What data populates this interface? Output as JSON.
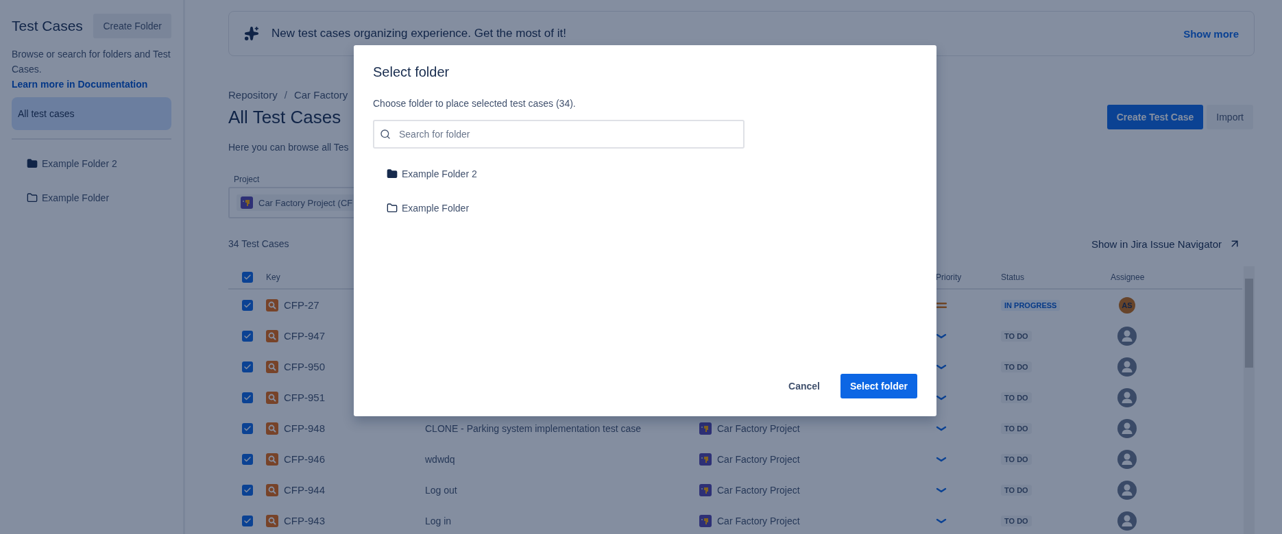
{
  "sidebar": {
    "title": "Test Cases",
    "create_button": "Create Folder",
    "description": "Browse or search for folders and Test Cases.",
    "doc_link": "Learn more in Documentation",
    "items": [
      {
        "label": "All test cases",
        "selected": true
      }
    ],
    "folders": [
      {
        "label": "Example Folder 2",
        "kind": "filled"
      },
      {
        "label": "Example Folder",
        "kind": "outline"
      }
    ]
  },
  "banner": {
    "text": "New test cases organizing experience. Get the most of it!",
    "link": "Show more"
  },
  "breadcrumb": {
    "separator": "/",
    "items": [
      "Repository",
      "Car Factory"
    ]
  },
  "page_title": "All Test Cases",
  "actions": [
    {
      "label": "Create Test Case",
      "kind": "primary"
    },
    {
      "label": "Import",
      "kind": "secondary"
    }
  ],
  "subtitle": "Here you can browse all Tes",
  "project_filter": {
    "label": "Project",
    "value": "Car Factory Project (CF"
  },
  "count": "34 Test Cases",
  "navigator_link": "Show in Jira Issue Navigator",
  "table": {
    "all_checked": true,
    "columns": {
      "key": "Key",
      "priority": "Priority",
      "status": "Status",
      "assignee": "Assignee"
    },
    "rows": [
      {
        "checked": true,
        "key": "CFP-27",
        "priority": {
          "kind": "medium"
        },
        "status": {
          "label": "IN PROGRESS",
          "kind": "in_progress"
        },
        "assignee": {
          "kind": "initials",
          "initials": "AS"
        }
      },
      {
        "checked": true,
        "key": "CFP-947",
        "priority": {
          "kind": "low"
        },
        "status": {
          "label": "TO DO",
          "kind": "todo"
        },
        "assignee": {
          "kind": "unassigned"
        }
      },
      {
        "checked": true,
        "key": "CFP-950",
        "priority": {
          "kind": "low"
        },
        "status": {
          "label": "TO DO",
          "kind": "todo"
        },
        "assignee": {
          "kind": "unassigned"
        }
      },
      {
        "checked": true,
        "key": "CFP-951",
        "priority": {
          "kind": "low"
        },
        "status": {
          "label": "TO DO",
          "kind": "todo"
        },
        "assignee": {
          "kind": "unassigned"
        }
      },
      {
        "checked": true,
        "key": "CFP-948",
        "summary": "CLONE - Parking system implementation test case",
        "project": "Car Factory Project",
        "priority": {
          "kind": "low"
        },
        "status": {
          "label": "TO DO",
          "kind": "todo"
        },
        "assignee": {
          "kind": "unassigned"
        }
      },
      {
        "checked": true,
        "key": "CFP-946",
        "summary": "wdwdq",
        "project": "Car Factory Project",
        "priority": {
          "kind": "low"
        },
        "status": {
          "label": "TO DO",
          "kind": "todo"
        },
        "assignee": {
          "kind": "unassigned"
        }
      },
      {
        "checked": true,
        "key": "CFP-944",
        "summary": "Log out",
        "project": "Car Factory Project",
        "priority": {
          "kind": "low"
        },
        "status": {
          "label": "TO DO",
          "kind": "todo"
        },
        "assignee": {
          "kind": "unassigned"
        }
      },
      {
        "checked": true,
        "key": "CFP-943",
        "summary": "Log in",
        "project": "Car Factory Project",
        "priority": {
          "kind": "low"
        },
        "status": {
          "label": "TO DO",
          "kind": "todo"
        },
        "assignee": {
          "kind": "unassigned"
        }
      }
    ]
  },
  "modal": {
    "title": "Select folder",
    "description": "Choose folder to place selected test cases (34).",
    "search": {
      "placeholder": "Search for folder"
    },
    "folders": [
      {
        "label": "Example Folder 2",
        "kind": "filled"
      },
      {
        "label": "Example Folder",
        "kind": "outline"
      }
    ],
    "buttons": [
      {
        "label": "Cancel",
        "kind": "subtle"
      },
      {
        "label": "Select folder",
        "kind": "primary"
      }
    ]
  }
}
